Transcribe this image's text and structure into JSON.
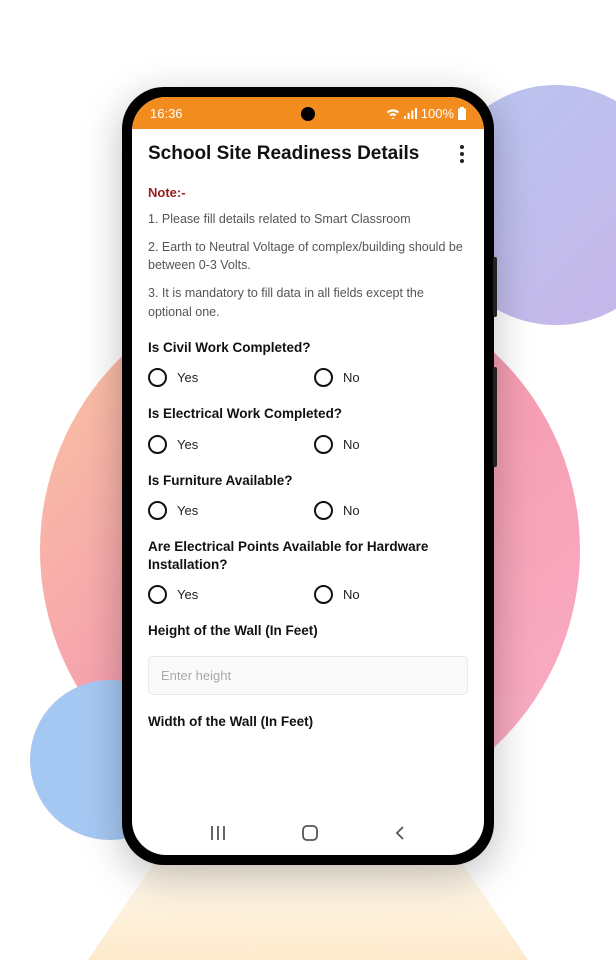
{
  "status": {
    "time": "16:36",
    "battery": "100%"
  },
  "header": {
    "title": "School Site Readiness Details"
  },
  "notes": {
    "label": "Note:-",
    "items": [
      "1. Please fill details related to Smart Classroom",
      "2. Earth to Neutral Voltage of complex/building should be between 0-3 Volts.",
      "3. It is mandatory to fill data in all fields except the optional one."
    ]
  },
  "questions": [
    {
      "label": "Is Civil Work Completed?",
      "options": [
        "Yes",
        "No"
      ]
    },
    {
      "label": "Is Electrical Work Completed?",
      "options": [
        "Yes",
        "No"
      ]
    },
    {
      "label": "Is Furniture Available?",
      "options": [
        "Yes",
        "No"
      ]
    },
    {
      "label": "Are Electrical Points Available for Hardware Installation?",
      "options": [
        "Yes",
        "No"
      ]
    }
  ],
  "inputs": {
    "height": {
      "label": "Height of the Wall (In Feet)",
      "placeholder": "Enter height"
    },
    "width": {
      "label": "Width of the Wall (In Feet)"
    }
  }
}
